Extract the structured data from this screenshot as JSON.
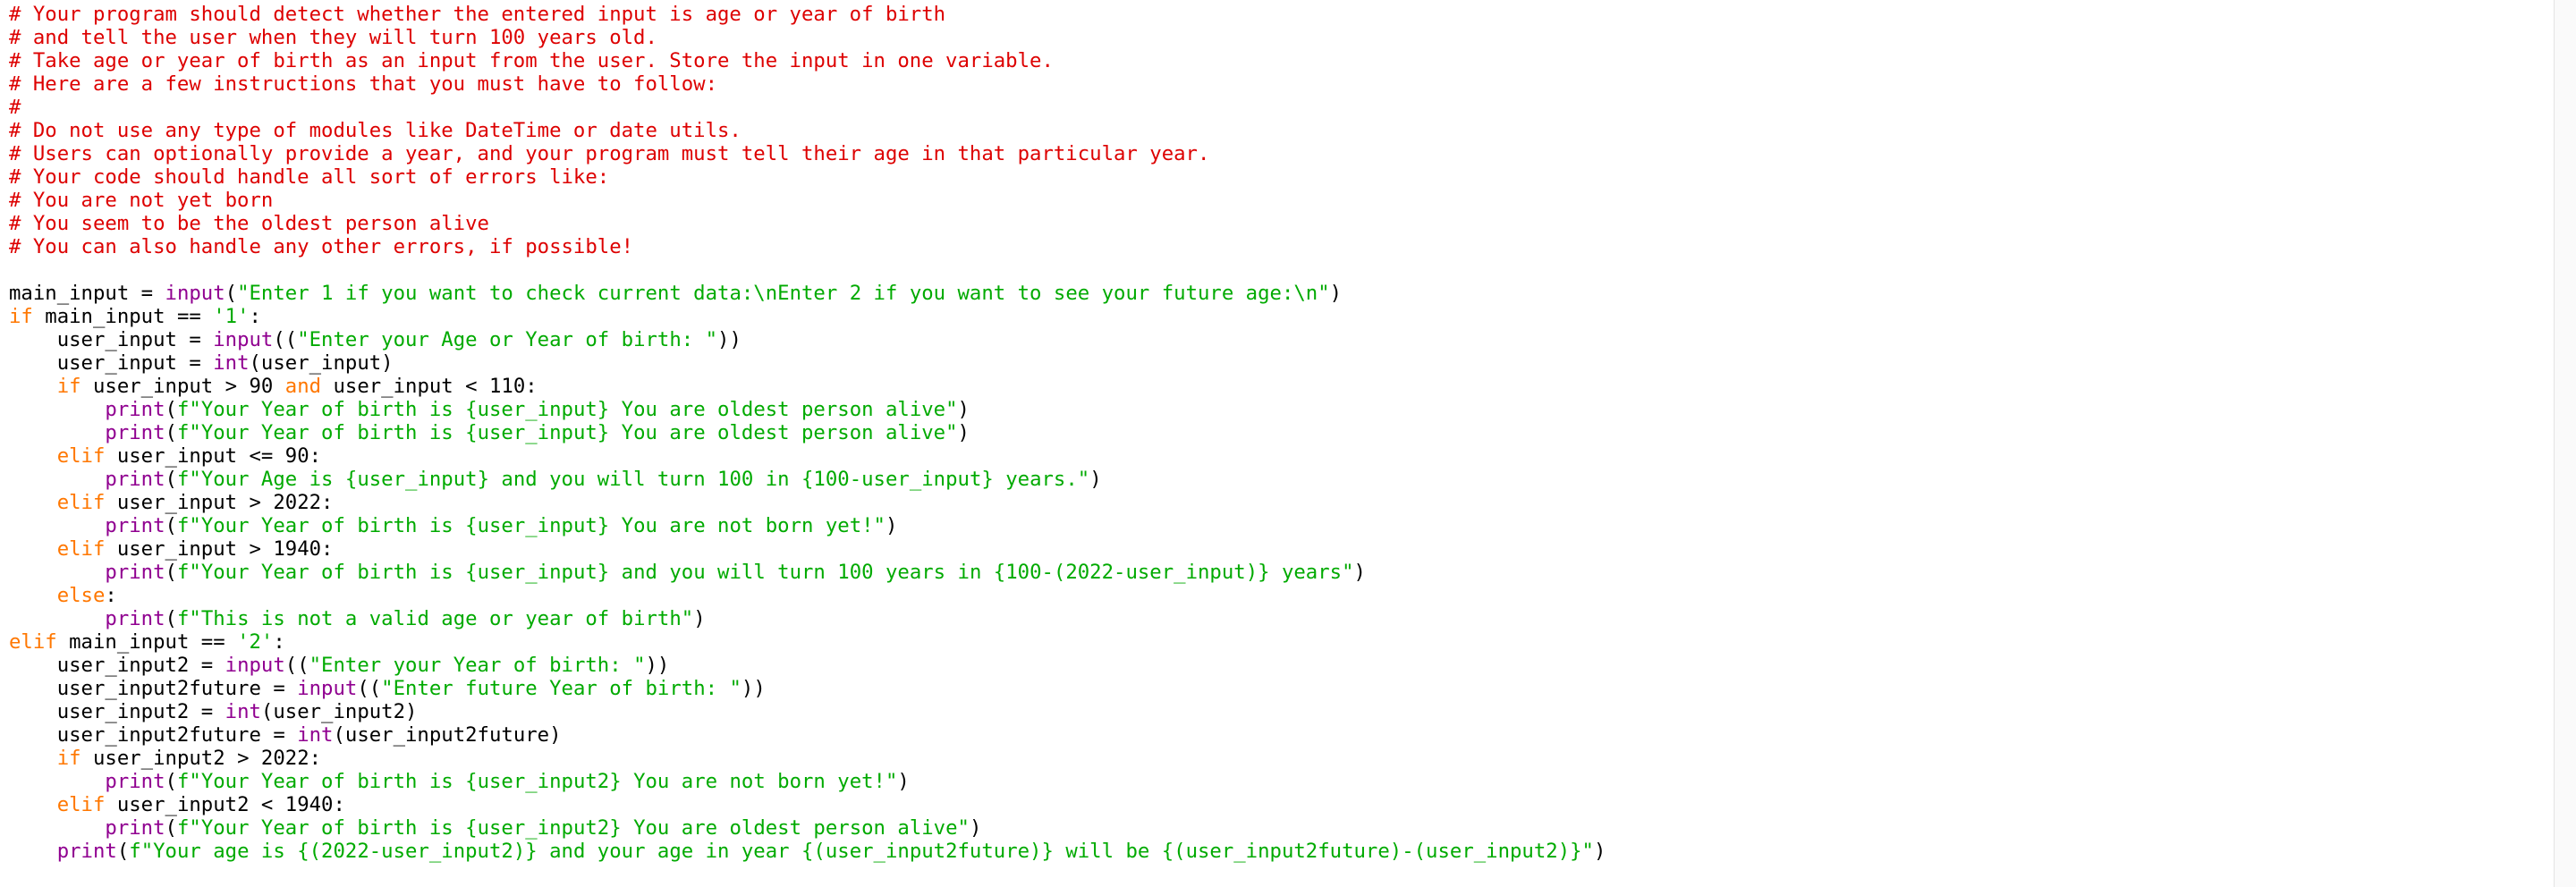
{
  "colors": {
    "comment": "#dd0000",
    "keyword": "#ff7700",
    "builtin": "#900090",
    "string": "#00aa00",
    "plain": "#000000",
    "background": "#ffffff"
  },
  "code_lines": [
    [
      {
        "t": "cmt",
        "s": "# Your program should detect whether the entered input is age or year of birth"
      }
    ],
    [
      {
        "t": "cmt",
        "s": "# and tell the user when they will turn 100 years old."
      }
    ],
    [
      {
        "t": "cmt",
        "s": "# Take age or year of birth as an input from the user. Store the input in one variable."
      }
    ],
    [
      {
        "t": "cmt",
        "s": "# Here are a few instructions that you must have to follow:"
      }
    ],
    [
      {
        "t": "cmt",
        "s": "#"
      }
    ],
    [
      {
        "t": "cmt",
        "s": "# Do not use any type of modules like DateTime or date utils."
      }
    ],
    [
      {
        "t": "cmt",
        "s": "# Users can optionally provide a year, and your program must tell their age in that particular year."
      }
    ],
    [
      {
        "t": "cmt",
        "s": "# Your code should handle all sort of errors like:"
      }
    ],
    [
      {
        "t": "cmt",
        "s": "# You are not yet born"
      }
    ],
    [
      {
        "t": "cmt",
        "s": "# You seem to be the oldest person alive"
      }
    ],
    [
      {
        "t": "cmt",
        "s": "# You can also handle any other errors, if possible!"
      }
    ],
    [],
    [
      {
        "t": "pl",
        "s": "main_input = "
      },
      {
        "t": "bi",
        "s": "input"
      },
      {
        "t": "pl",
        "s": "("
      },
      {
        "t": "str",
        "s": "\"Enter 1 if you want to check current data:\\nEnter 2 if you want to see your future age:\\n\""
      },
      {
        "t": "pl",
        "s": ")"
      }
    ],
    [
      {
        "t": "kw",
        "s": "if"
      },
      {
        "t": "pl",
        "s": " main_input == "
      },
      {
        "t": "str",
        "s": "'1'"
      },
      {
        "t": "pl",
        "s": ":"
      }
    ],
    [
      {
        "t": "pl",
        "s": "    user_input = "
      },
      {
        "t": "bi",
        "s": "input"
      },
      {
        "t": "pl",
        "s": "(("
      },
      {
        "t": "str",
        "s": "\"Enter your Age or Year of birth: \""
      },
      {
        "t": "pl",
        "s": "))"
      }
    ],
    [
      {
        "t": "pl",
        "s": "    user_input = "
      },
      {
        "t": "bi",
        "s": "int"
      },
      {
        "t": "pl",
        "s": "(user_input)"
      }
    ],
    [
      {
        "t": "pl",
        "s": "    "
      },
      {
        "t": "kw",
        "s": "if"
      },
      {
        "t": "pl",
        "s": " user_input > 90 "
      },
      {
        "t": "kw",
        "s": "and"
      },
      {
        "t": "pl",
        "s": " user_input < 110:"
      }
    ],
    [
      {
        "t": "pl",
        "s": "        "
      },
      {
        "t": "bi",
        "s": "print"
      },
      {
        "t": "pl",
        "s": "("
      },
      {
        "t": "str",
        "s": "f\"Your Year of birth is {user_input} You are oldest person alive\""
      },
      {
        "t": "pl",
        "s": ")"
      }
    ],
    [
      {
        "t": "pl",
        "s": "        "
      },
      {
        "t": "bi",
        "s": "print"
      },
      {
        "t": "pl",
        "s": "("
      },
      {
        "t": "str",
        "s": "f\"Your Year of birth is {user_input} You are oldest person alive\""
      },
      {
        "t": "pl",
        "s": ")"
      }
    ],
    [
      {
        "t": "pl",
        "s": "    "
      },
      {
        "t": "kw",
        "s": "elif"
      },
      {
        "t": "pl",
        "s": " user_input <= 90:"
      }
    ],
    [
      {
        "t": "pl",
        "s": "        "
      },
      {
        "t": "bi",
        "s": "print"
      },
      {
        "t": "pl",
        "s": "("
      },
      {
        "t": "str",
        "s": "f\"Your Age is {user_input} and you will turn 100 in {100-user_input} years.\""
      },
      {
        "t": "pl",
        "s": ")"
      }
    ],
    [
      {
        "t": "pl",
        "s": "    "
      },
      {
        "t": "kw",
        "s": "elif"
      },
      {
        "t": "pl",
        "s": " user_input > 2022:"
      }
    ],
    [
      {
        "t": "pl",
        "s": "        "
      },
      {
        "t": "bi",
        "s": "print"
      },
      {
        "t": "pl",
        "s": "("
      },
      {
        "t": "str",
        "s": "f\"Your Year of birth is {user_input} You are not born yet!\""
      },
      {
        "t": "pl",
        "s": ")"
      }
    ],
    [
      {
        "t": "pl",
        "s": "    "
      },
      {
        "t": "kw",
        "s": "elif"
      },
      {
        "t": "pl",
        "s": " user_input > 1940:"
      }
    ],
    [
      {
        "t": "pl",
        "s": "        "
      },
      {
        "t": "bi",
        "s": "print"
      },
      {
        "t": "pl",
        "s": "("
      },
      {
        "t": "str",
        "s": "f\"Your Year of birth is {user_input} and you will turn 100 years in {100-(2022-user_input)} years\""
      },
      {
        "t": "pl",
        "s": ")"
      }
    ],
    [
      {
        "t": "pl",
        "s": "    "
      },
      {
        "t": "kw",
        "s": "else"
      },
      {
        "t": "pl",
        "s": ":"
      }
    ],
    [
      {
        "t": "pl",
        "s": "        "
      },
      {
        "t": "bi",
        "s": "print"
      },
      {
        "t": "pl",
        "s": "("
      },
      {
        "t": "str",
        "s": "f\"This is not a valid age or year of birth\""
      },
      {
        "t": "pl",
        "s": ")"
      }
    ],
    [
      {
        "t": "kw",
        "s": "elif"
      },
      {
        "t": "pl",
        "s": " main_input == "
      },
      {
        "t": "str",
        "s": "'2'"
      },
      {
        "t": "pl",
        "s": ":"
      }
    ],
    [
      {
        "t": "pl",
        "s": "    user_input2 = "
      },
      {
        "t": "bi",
        "s": "input"
      },
      {
        "t": "pl",
        "s": "(("
      },
      {
        "t": "str",
        "s": "\"Enter your Year of birth: \""
      },
      {
        "t": "pl",
        "s": "))"
      }
    ],
    [
      {
        "t": "pl",
        "s": "    user_input2future = "
      },
      {
        "t": "bi",
        "s": "input"
      },
      {
        "t": "pl",
        "s": "(("
      },
      {
        "t": "str",
        "s": "\"Enter future Year of birth: \""
      },
      {
        "t": "pl",
        "s": "))"
      }
    ],
    [
      {
        "t": "pl",
        "s": "    user_input2 = "
      },
      {
        "t": "bi",
        "s": "int"
      },
      {
        "t": "pl",
        "s": "(user_input2)"
      }
    ],
    [
      {
        "t": "pl",
        "s": "    user_input2future = "
      },
      {
        "t": "bi",
        "s": "int"
      },
      {
        "t": "pl",
        "s": "(user_input2future)"
      }
    ],
    [
      {
        "t": "pl",
        "s": "    "
      },
      {
        "t": "kw",
        "s": "if"
      },
      {
        "t": "pl",
        "s": " user_input2 > 2022:"
      }
    ],
    [
      {
        "t": "pl",
        "s": "        "
      },
      {
        "t": "bi",
        "s": "print"
      },
      {
        "t": "pl",
        "s": "("
      },
      {
        "t": "str",
        "s": "f\"Your Year of birth is {user_input2} You are not born yet!\""
      },
      {
        "t": "pl",
        "s": ")"
      }
    ],
    [
      {
        "t": "pl",
        "s": "    "
      },
      {
        "t": "kw",
        "s": "elif"
      },
      {
        "t": "pl",
        "s": " user_input2 < 1940:"
      }
    ],
    [
      {
        "t": "pl",
        "s": "        "
      },
      {
        "t": "bi",
        "s": "print"
      },
      {
        "t": "pl",
        "s": "("
      },
      {
        "t": "str",
        "s": "f\"Your Year of birth is {user_input2} You are oldest person alive\""
      },
      {
        "t": "pl",
        "s": ")"
      }
    ],
    [
      {
        "t": "pl",
        "s": "    "
      },
      {
        "t": "bi",
        "s": "print"
      },
      {
        "t": "pl",
        "s": "("
      },
      {
        "t": "str",
        "s": "f\"Your age is {(2022-user_input2)} and your age in year {(user_input2future)} will be {(user_input2future)-(user_input2)}\""
      },
      {
        "t": "pl",
        "s": ")"
      }
    ]
  ]
}
